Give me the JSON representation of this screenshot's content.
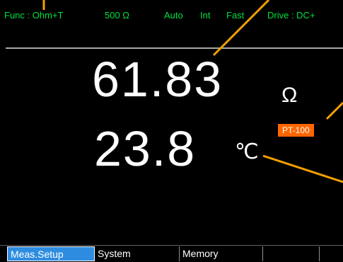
{
  "status": {
    "function": "Func : Ohm+T",
    "range": "500 Ω",
    "auto": "Auto",
    "trigger": "Int",
    "speed": "Fast",
    "drive": "Drive : DC+"
  },
  "display": {
    "primary_value": "61.83",
    "primary_unit": "Ω",
    "secondary_value": "23.8",
    "secondary_unit": "℃",
    "sensor": "PT-100"
  },
  "menu": {
    "keys": [
      "Meas.Setup",
      "System",
      "Memory",
      "",
      ""
    ],
    "active_index": 0
  },
  "colors": {
    "status_text": "#00e040",
    "reading_text": "#ffffff",
    "sensor_badge": "#ff6600",
    "menu_active": "#2e8de0",
    "callout_line": "#f5a000"
  }
}
